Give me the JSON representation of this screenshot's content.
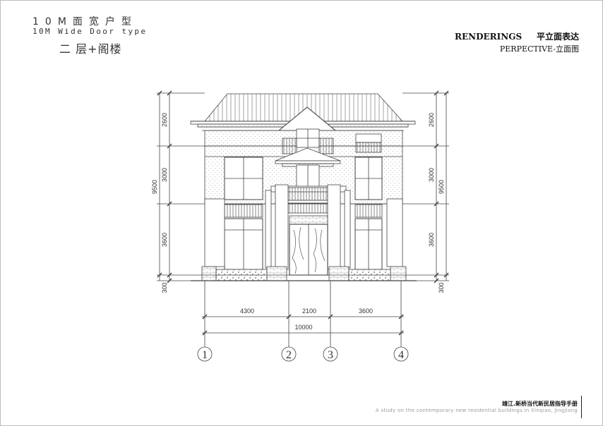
{
  "header": {
    "title_cn": "10M面宽户型",
    "title_en": "10M Wide Door type",
    "subtitle": "二 层+阁楼"
  },
  "top_right": {
    "renderings": "RENDERINGS     平立面表达",
    "perspective": "PERPECTIVE-立面图"
  },
  "footer": {
    "cn": "靖江.新桥当代新民居指导手册",
    "en": "A study on the contemporary new residential buildings in Xinqiao, Jingjiang"
  },
  "dimensions": {
    "left_segments": [
      "2600",
      "3000",
      "3600"
    ],
    "left_total": "9500",
    "left_base": "300",
    "right_segments": [
      "2600",
      "3000",
      "3600"
    ],
    "right_total": "9500",
    "right_base": "300",
    "bottom_segments": [
      "4300",
      "2100",
      "3600"
    ],
    "bottom_total": "10000"
  },
  "axes": [
    "1",
    "2",
    "3",
    "4"
  ]
}
